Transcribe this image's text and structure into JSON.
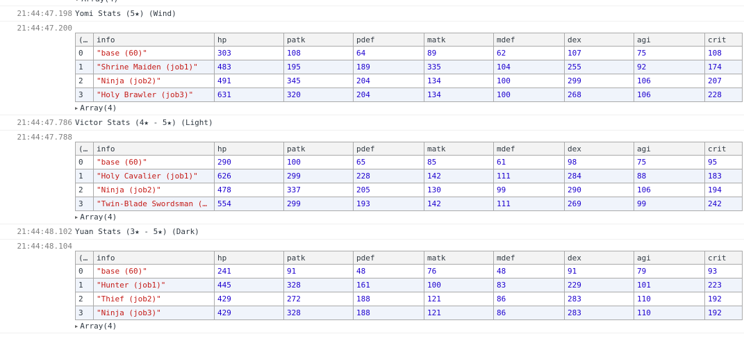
{
  "top_array_label": "Array(4)",
  "columns": [
    "(…",
    "info",
    "hp",
    "patk",
    "pdef",
    "matk",
    "mdef",
    "dex",
    "agi",
    "crit"
  ],
  "blocks": [
    {
      "ts_title": "21:44:47.198",
      "title": "Yomi Stats (5★) (Wind)",
      "ts_table": "21:44:47.200",
      "rows": [
        [
          "0",
          "\"base (60)\"",
          "303",
          "108",
          "64",
          "89",
          "62",
          "107",
          "75",
          "108"
        ],
        [
          "1",
          "\"Shrine Maiden (job1)\"",
          "483",
          "195",
          "189",
          "335",
          "104",
          "255",
          "92",
          "174"
        ],
        [
          "2",
          "\"Ninja (job2)\"",
          "491",
          "345",
          "204",
          "134",
          "100",
          "299",
          "106",
          "207"
        ],
        [
          "3",
          "\"Holy Brawler (job3)\"",
          "631",
          "320",
          "204",
          "134",
          "100",
          "268",
          "106",
          "228"
        ]
      ],
      "array_label": "Array(4)"
    },
    {
      "ts_title": "21:44:47.786",
      "title": "Victor Stats (4★ - 5★) (Light)",
      "ts_table": "21:44:47.788",
      "rows": [
        [
          "0",
          "\"base (60)\"",
          "290",
          "100",
          "65",
          "85",
          "61",
          "98",
          "75",
          "95"
        ],
        [
          "1",
          "\"Holy Cavalier (job1)\"",
          "626",
          "299",
          "228",
          "142",
          "111",
          "284",
          "88",
          "183"
        ],
        [
          "2",
          "\"Ninja (job2)\"",
          "478",
          "337",
          "205",
          "130",
          "99",
          "290",
          "106",
          "194"
        ],
        [
          "3",
          "\"Twin-Blade Swordsman (j…",
          "554",
          "299",
          "193",
          "142",
          "111",
          "269",
          "99",
          "242"
        ]
      ],
      "array_label": "Array(4)"
    },
    {
      "ts_title": "21:44:48.102",
      "title": "Yuan Stats (3★ - 5★) (Dark)",
      "ts_table": "21:44:48.104",
      "rows": [
        [
          "0",
          "\"base (60)\"",
          "241",
          "91",
          "48",
          "76",
          "48",
          "91",
          "79",
          "93"
        ],
        [
          "1",
          "\"Hunter (job1)\"",
          "445",
          "328",
          "161",
          "100",
          "83",
          "229",
          "101",
          "223"
        ],
        [
          "2",
          "\"Thief (job2)\"",
          "429",
          "272",
          "188",
          "121",
          "86",
          "283",
          "110",
          "192"
        ],
        [
          "3",
          "\"Ninja (job3)\"",
          "429",
          "328",
          "188",
          "121",
          "86",
          "283",
          "110",
          "192"
        ]
      ],
      "array_label": "Array(4)"
    }
  ]
}
